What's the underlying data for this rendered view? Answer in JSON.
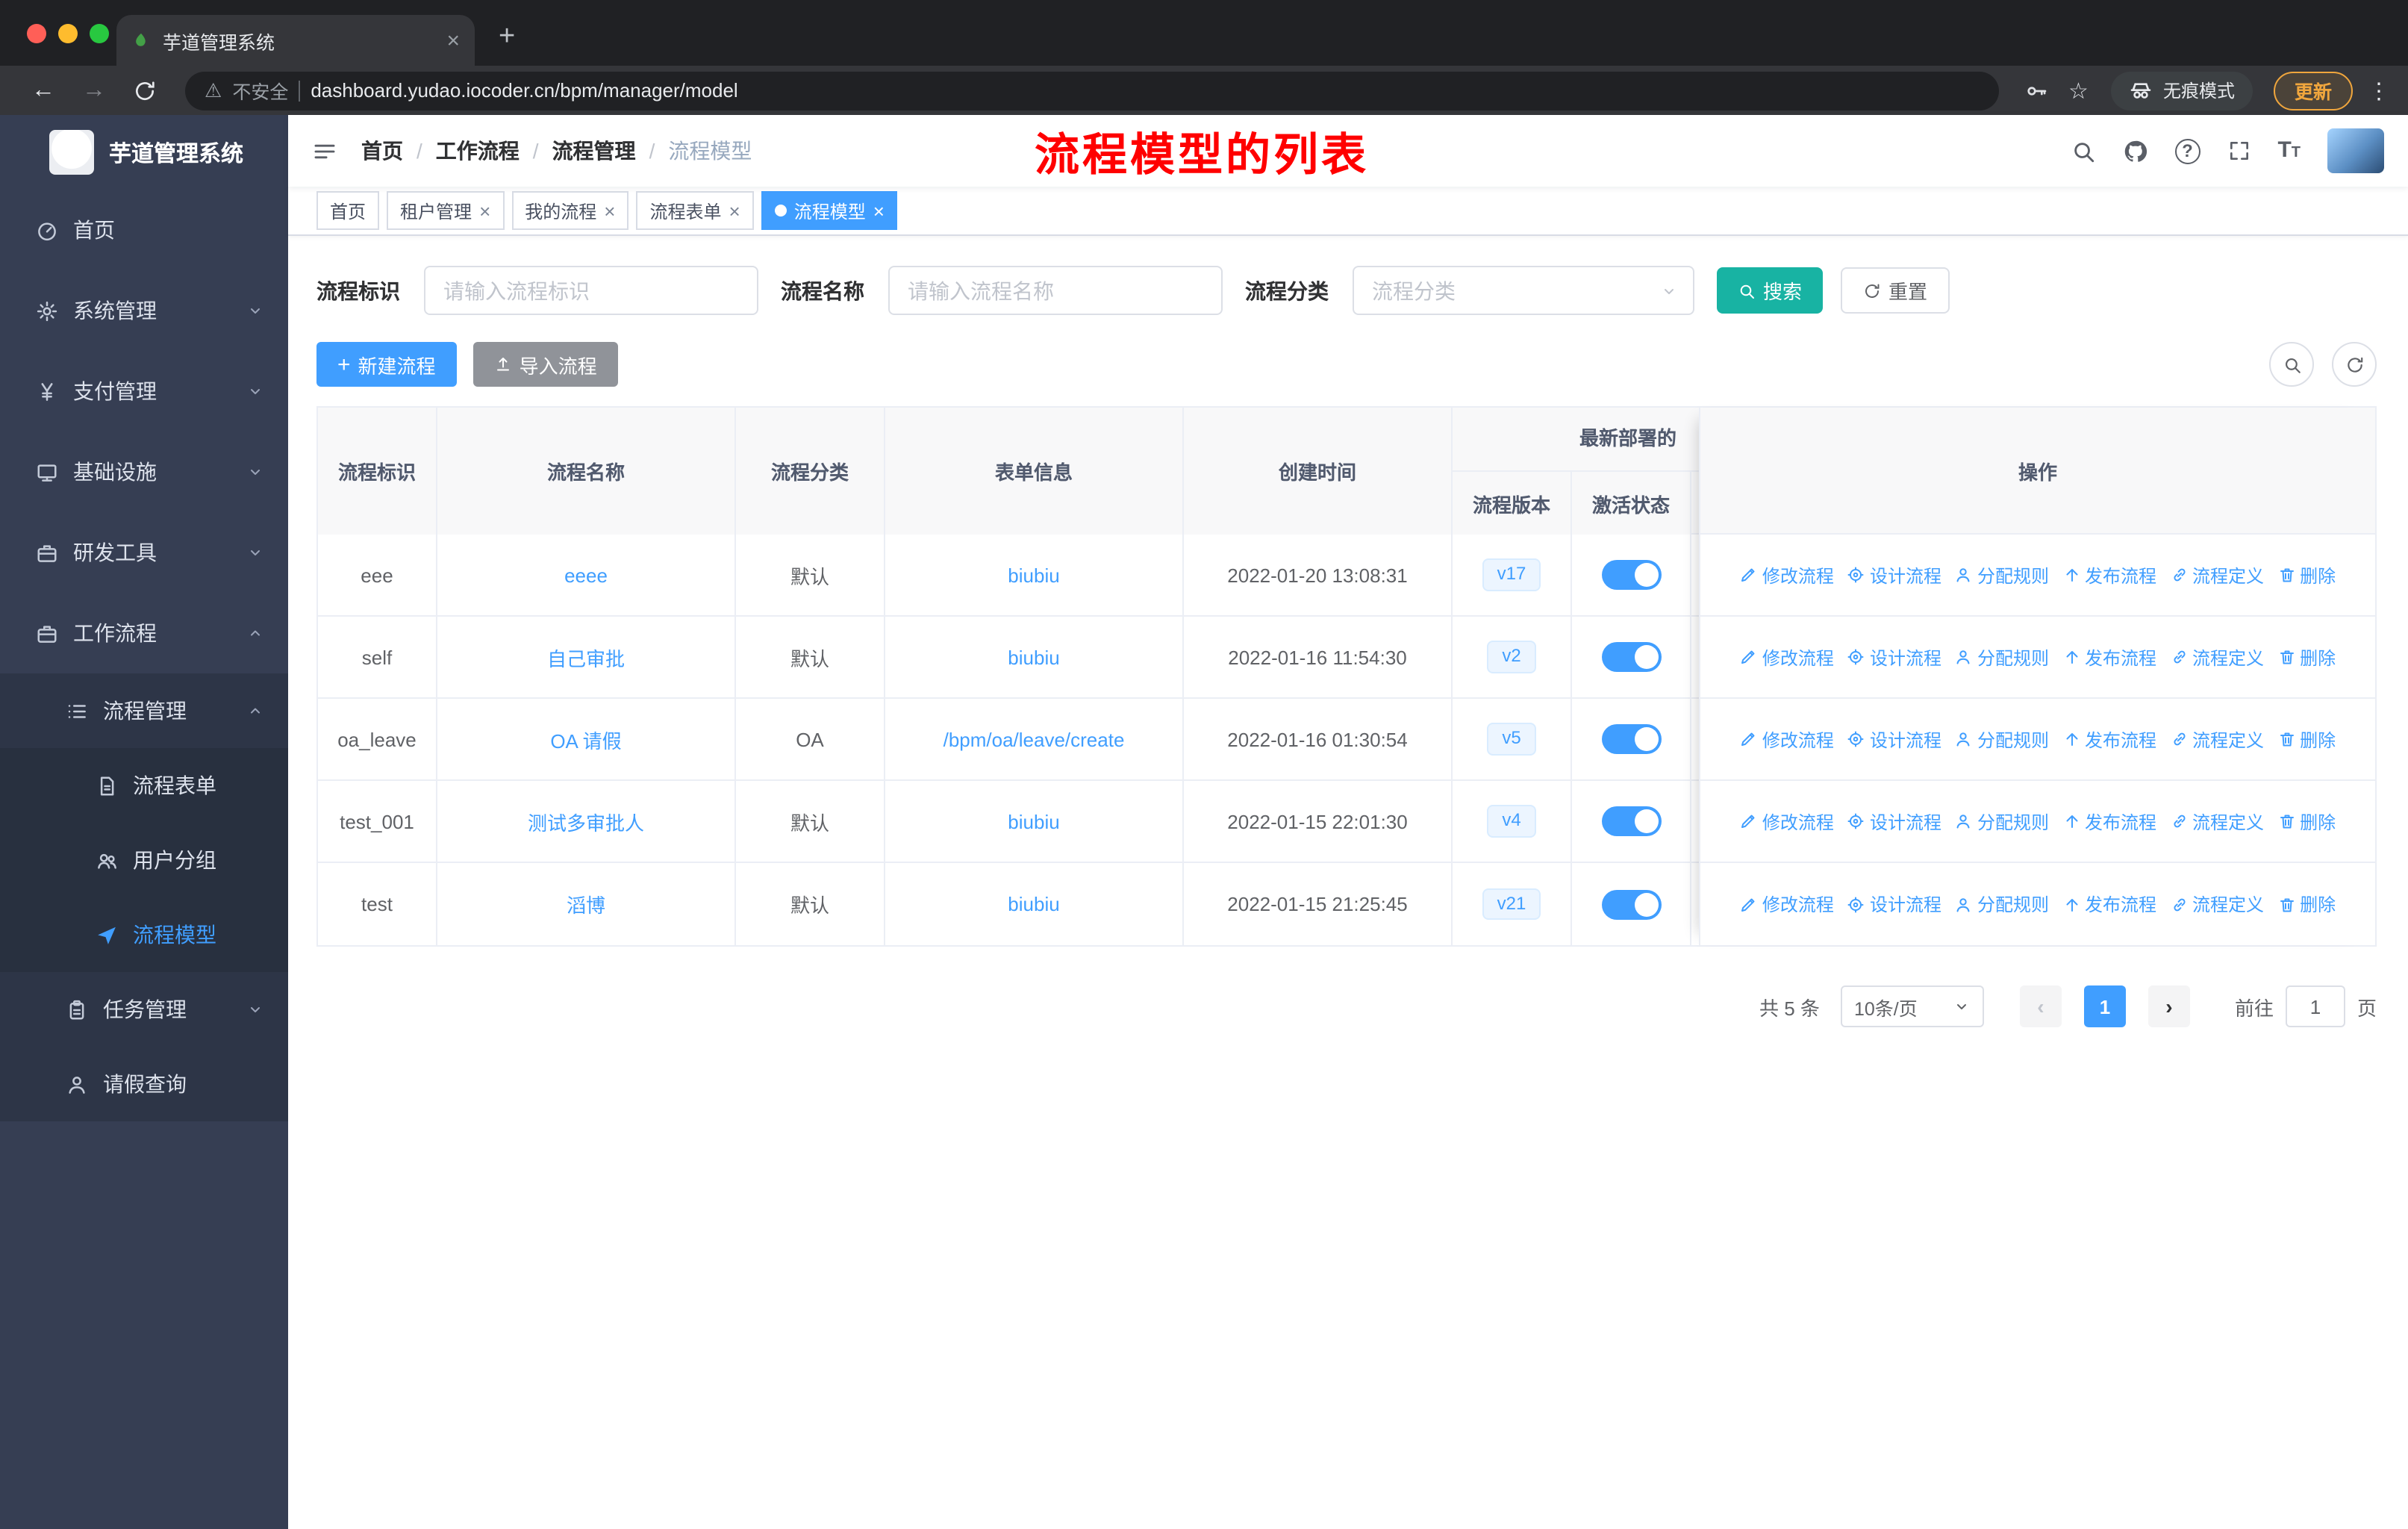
{
  "browser": {
    "tab_title": "芋道管理系统",
    "security_label": "不安全",
    "url": "dashboard.yudao.iocoder.cn/bpm/manager/model",
    "incognito_label": "无痕模式",
    "update_label": "更新"
  },
  "sidebar": {
    "app_title": "芋道管理系统",
    "items": [
      {
        "name": "home",
        "label": "首页",
        "icon": "gauge",
        "level": 1,
        "chevron": null,
        "active": false
      },
      {
        "name": "system",
        "label": "系统管理",
        "icon": "gear",
        "level": 1,
        "chevron": "down",
        "active": false
      },
      {
        "name": "payment",
        "label": "支付管理",
        "icon": "yen",
        "level": 1,
        "chevron": "down",
        "active": false
      },
      {
        "name": "infra",
        "label": "基础设施",
        "icon": "monitor",
        "level": 1,
        "chevron": "down",
        "active": false
      },
      {
        "name": "devtools",
        "label": "研发工具",
        "icon": "briefcase",
        "level": 1,
        "chevron": "down",
        "active": false
      },
      {
        "name": "workflow",
        "label": "工作流程",
        "icon": "briefcase",
        "level": 1,
        "chevron": "up",
        "active": false
      },
      {
        "name": "process-mgmt",
        "label": "流程管理",
        "icon": "list",
        "level": 2,
        "chevron": "up",
        "active": false
      },
      {
        "name": "process-form",
        "label": "流程表单",
        "icon": "doc",
        "level": 3,
        "chevron": null,
        "active": false
      },
      {
        "name": "user-group",
        "label": "用户分组",
        "icon": "users",
        "level": 3,
        "chevron": null,
        "active": false
      },
      {
        "name": "process-model",
        "label": "流程模型",
        "icon": "send",
        "level": 3,
        "chevron": null,
        "active": true
      },
      {
        "name": "task-mgmt",
        "label": "任务管理",
        "icon": "clipboard",
        "level": 2,
        "chevron": "down",
        "active": false
      },
      {
        "name": "leave-query",
        "label": "请假查询",
        "icon": "person",
        "level": 2,
        "chevron": null,
        "active": false
      }
    ]
  },
  "navbar": {
    "breadcrumb": [
      "首页",
      "工作流程",
      "流程管理",
      "流程模型"
    ],
    "annotation": "流程模型的列表"
  },
  "tags": [
    {
      "name": "home",
      "label": "首页",
      "closable": false,
      "active": false
    },
    {
      "name": "tenant",
      "label": "租户管理",
      "closable": true,
      "active": false
    },
    {
      "name": "my-process",
      "label": "我的流程",
      "closable": true,
      "active": false
    },
    {
      "name": "process-form",
      "label": "流程表单",
      "closable": true,
      "active": false
    },
    {
      "name": "process-model",
      "label": "流程模型",
      "closable": true,
      "active": true
    }
  ],
  "filters": {
    "key_label": "流程标识",
    "key_placeholder": "请输入流程标识",
    "name_label": "流程名称",
    "name_placeholder": "请输入流程名称",
    "category_label": "流程分类",
    "category_placeholder": "流程分类",
    "search_label": "搜索",
    "reset_label": "重置"
  },
  "actions": {
    "create_label": "新建流程",
    "import_label": "导入流程"
  },
  "table": {
    "columns": [
      "流程标识",
      "流程名称",
      "流程分类",
      "表单信息",
      "创建时间",
      "流程版本",
      "激活状态",
      "操作"
    ],
    "group_header": "最新部署的",
    "rows": [
      {
        "key": "eee",
        "name": "eeee",
        "category": "默认",
        "form": "biubiu",
        "created": "2022-01-20 13:08:31",
        "version": "v17",
        "active": true
      },
      {
        "key": "self",
        "name": "自己审批",
        "category": "默认",
        "form": "biubiu",
        "created": "2022-01-16 11:54:30",
        "version": "v2",
        "active": true
      },
      {
        "key": "oa_leave",
        "name": "OA 请假",
        "category": "OA",
        "form": "/bpm/oa/leave/create",
        "created": "2022-01-16 01:30:54",
        "version": "v5",
        "active": true
      },
      {
        "key": "test_001",
        "name": "测试多审批人",
        "category": "默认",
        "form": "biubiu",
        "created": "2022-01-15 22:01:30",
        "version": "v4",
        "active": true
      },
      {
        "key": "test",
        "name": "滔博",
        "category": "默认",
        "form": "biubiu",
        "created": "2022-01-15 21:25:45",
        "version": "v21",
        "active": true
      }
    ],
    "ops": [
      {
        "label": "修改流程",
        "icon": "pencil",
        "name": "edit"
      },
      {
        "label": "设计流程",
        "icon": "design",
        "name": "design"
      },
      {
        "label": "分配规则",
        "icon": "person",
        "name": "assign-rule"
      },
      {
        "label": "发布流程",
        "icon": "publish",
        "name": "deploy"
      },
      {
        "label": "流程定义",
        "icon": "linkc",
        "name": "definition"
      },
      {
        "label": "删除",
        "icon": "trash",
        "name": "delete"
      }
    ]
  },
  "pagination": {
    "total_label": "共 5 条",
    "page_size": "10条/页",
    "pages": [
      "1"
    ],
    "goto_label": "前往",
    "goto_value": "1",
    "page_suffix": "页"
  },
  "colors": {
    "accent": "#409eff",
    "search_button": "#18b3a3",
    "annotation_red": "#ff0000",
    "toggle_on": "#409eff",
    "update_chip": "#f0a63d",
    "sidebar_bg": "#363e53"
  }
}
